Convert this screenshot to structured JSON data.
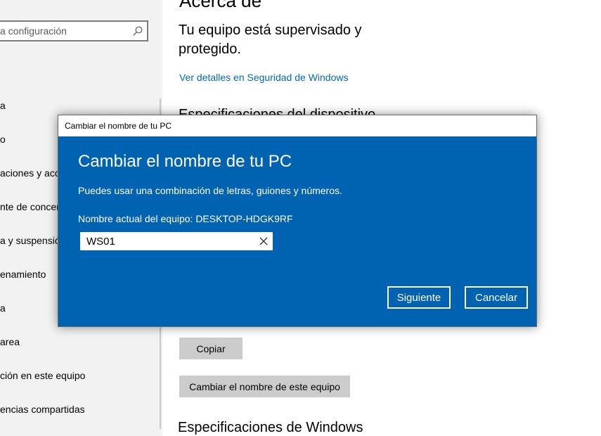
{
  "sidebar": {
    "search_placeholder": "a configuración",
    "items": [
      {
        "label": "a"
      },
      {
        "label": "o"
      },
      {
        "label": "aciones y acciones"
      },
      {
        "label": "nte de concentración"
      },
      {
        "label": "a y suspensión"
      },
      {
        "label": "enamiento"
      },
      {
        "label": "a"
      },
      {
        "label": "area"
      },
      {
        "label": "ción en este equipo"
      },
      {
        "label": "encias compartidas"
      }
    ]
  },
  "main": {
    "page_title": "Acerca de",
    "protection_text": "Tu equipo está supervisado y protegido.",
    "security_link": "Ver detalles en Seguridad de Windows",
    "device_specs_heading": "Especificaciones del dispositivo",
    "copy_button": "Copiar",
    "rename_button": "Cambiar el nombre de este equipo",
    "windows_specs_heading": "Especificaciones de Windows"
  },
  "dialog": {
    "window_title": "Cambiar el nombre de tu PC",
    "heading": "Cambiar el nombre de tu PC",
    "description": "Puedes usar una combinación de letras, guiones y números.",
    "current_name": "Nombre actual del equipo: DESKTOP-HDGK9RF",
    "input_value": "WS01",
    "next_button": "Siguiente",
    "cancel_button": "Cancelar",
    "accent_color": "#0063b1"
  },
  "icons": {
    "search": "search-icon",
    "clear": "close-icon"
  }
}
